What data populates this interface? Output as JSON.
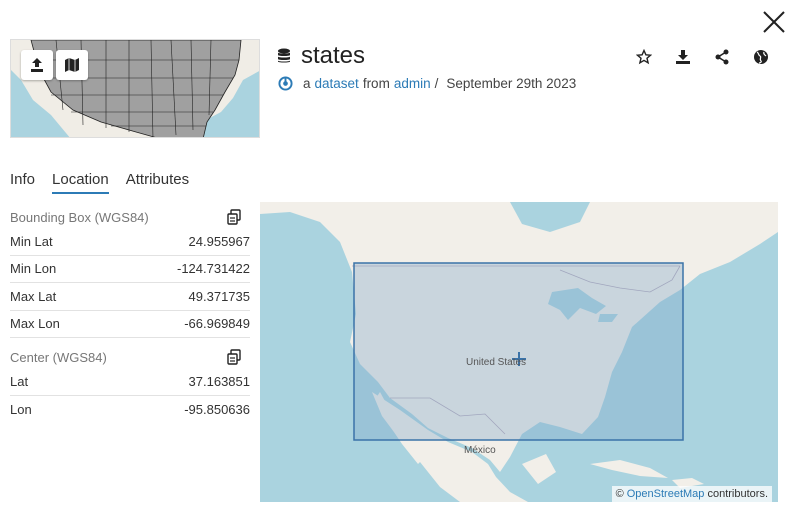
{
  "header": {
    "title": "states",
    "subtitle": {
      "prefix": "a",
      "type_link": "dataset",
      "from_word": "from",
      "owner_link": "admin",
      "separator": "/",
      "date": "September 29th 2023"
    }
  },
  "thumbnail": {
    "buttons": [
      {
        "icon": "upload-icon"
      },
      {
        "icon": "map-icon"
      }
    ]
  },
  "actions": [
    {
      "icon": "star-icon"
    },
    {
      "icon": "download-icon"
    },
    {
      "icon": "share-icon"
    },
    {
      "icon": "globe-icon"
    }
  ],
  "tabs": [
    {
      "label": "Info",
      "active": false
    },
    {
      "label": "Location",
      "active": true
    },
    {
      "label": "Attributes",
      "active": false
    }
  ],
  "bbox": {
    "heading": "Bounding Box (WGS84)",
    "rows": [
      {
        "label": "Min Lat",
        "value": "24.955967"
      },
      {
        "label": "Min Lon",
        "value": "-124.731422"
      },
      {
        "label": "Max Lat",
        "value": "49.371735"
      },
      {
        "label": "Max Lon",
        "value": "-66.969849"
      }
    ]
  },
  "center": {
    "heading": "Center (WGS84)",
    "rows": [
      {
        "label": "Lat",
        "value": "37.163851"
      },
      {
        "label": "Lon",
        "value": "-95.850636"
      }
    ]
  },
  "map": {
    "labels": {
      "us": "United States",
      "mexico": "México"
    },
    "attribution": {
      "symbol": "©",
      "link": "OpenStreetMap",
      "suffix": "contributors."
    }
  },
  "colors": {
    "accent": "#2c7bb6",
    "water": "#aad3df",
    "land": "#f2efe9",
    "bbox_fill": "#7fa7c9",
    "bbox_stroke": "#3a73a8"
  }
}
